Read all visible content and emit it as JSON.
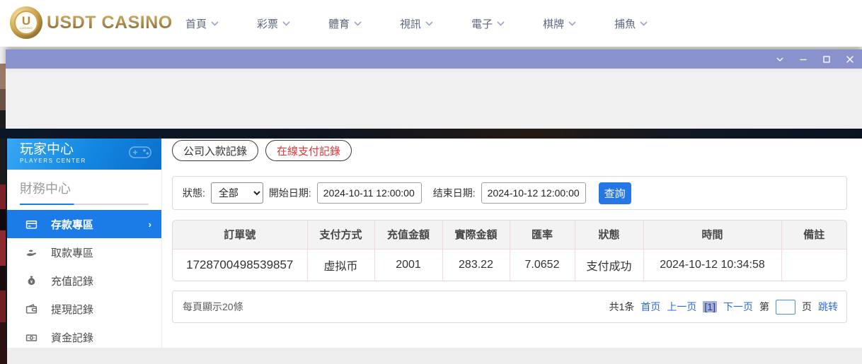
{
  "brand": {
    "name": "USDT CASINO",
    "coin_letter": "U",
    "coin_sub": "CASINO"
  },
  "nav": {
    "items": [
      {
        "label": "首頁"
      },
      {
        "label": "彩票"
      },
      {
        "label": "體育"
      },
      {
        "label": "視訊"
      },
      {
        "label": "電子"
      },
      {
        "label": "棋牌"
      },
      {
        "label": "捕魚"
      }
    ]
  },
  "window": {
    "controls": [
      "collapse",
      "minimize",
      "maximize",
      "close"
    ]
  },
  "sidebar": {
    "title": "玩家中心",
    "subtitle": "PLAYERS CENTER",
    "section_title": "財務中心",
    "items": [
      {
        "label": "存款專區",
        "icon": "bank-card-icon",
        "active": true
      },
      {
        "label": "取款專區",
        "icon": "hand-coin-icon",
        "active": false
      },
      {
        "label": "充值記錄",
        "icon": "money-bag-icon",
        "active": false
      },
      {
        "label": "提現記錄",
        "icon": "wallet-icon",
        "active": false
      },
      {
        "label": "資金記錄",
        "icon": "banknote-icon",
        "active": false
      }
    ]
  },
  "main": {
    "tabs": [
      {
        "label": "公司入款記錄",
        "active": false
      },
      {
        "label": "在線支付記錄",
        "active": true
      }
    ],
    "filters": {
      "status_label": "狀態:",
      "status_value": "全部",
      "start_label": "開始日期:",
      "start_value": "2024-10-11 12:00:00",
      "end_label": "结束日期:",
      "end_value": "2024-10-12 12:00:00",
      "search_label": "查詢"
    },
    "table": {
      "headers": [
        "訂單號",
        "支付方式",
        "充值金額",
        "實際金額",
        "匯率",
        "狀態",
        "時間",
        "備註"
      ],
      "rows": [
        [
          "1728700498539857",
          "虚拟币",
          "2001",
          "283.22",
          "7.0652",
          "支付成功",
          "2024-10-12 10:34:58",
          ""
        ]
      ]
    },
    "pagination": {
      "page_size_text": "每頁顯示20條",
      "total_text": "共1条",
      "first_label": "首页",
      "prev_label": "上一页",
      "current_label": "[1]",
      "next_label": "下一页",
      "jump_prefix": "第",
      "jump_suffix": "页",
      "jump_label": "跳转",
      "jump_value": ""
    }
  },
  "colors": {
    "accent_blue": "#1b7ce8",
    "button_blue": "#2577e5",
    "tab_red": "#e63434",
    "titlebar_purple": "#8a92ce",
    "brand_gold": "#b08d4f",
    "dark_band": "#0d1626",
    "table_border_pink": "#f2dada"
  }
}
